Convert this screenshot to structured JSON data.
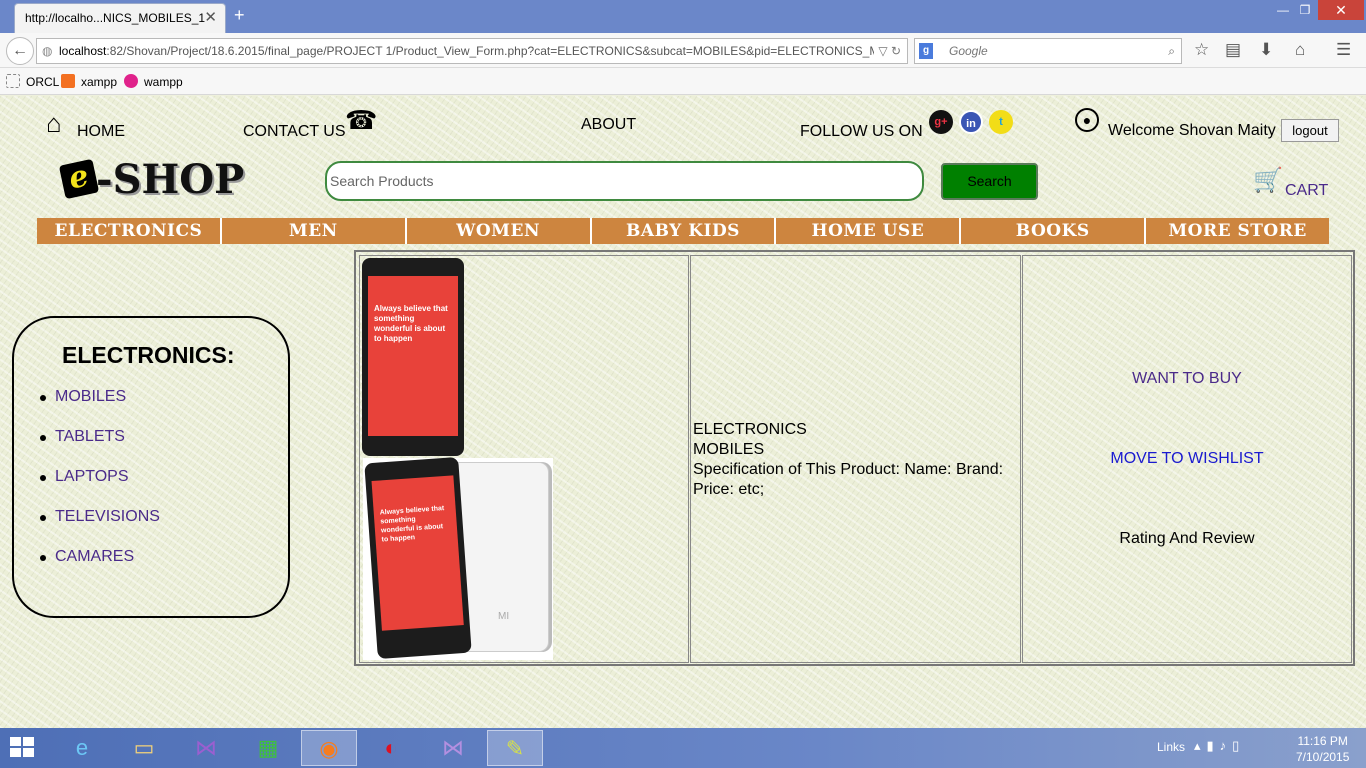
{
  "browser": {
    "tab_title": "http://localho...NICS_MOBILES_1",
    "tab_close": "✕",
    "new_tab": "+",
    "window_min": "—",
    "window_max": "❐",
    "window_close": "✕",
    "url_host": "localhost",
    "url_rest": ":82/Shovan/Project/18.6.2015/final_page/PROJECT 1/Product_View_Form.php?cat=ELECTRONICS&subcat=MOBILES&pid=ELECTRONICS_MOBI",
    "search_engine_badge": "g",
    "search_placeholder": "Google",
    "bookmarks": [
      {
        "label": "ORCL"
      },
      {
        "label": "xampp"
      },
      {
        "label": "wampp"
      }
    ]
  },
  "header": {
    "home": "HOME",
    "contact": "CONTACT US",
    "about": "ABOUT",
    "follow": "FOLLOW US ON",
    "social": [
      "g+",
      "in",
      "t"
    ],
    "welcome": "Welcome Shovan Maity",
    "logout": "logout"
  },
  "logo": {
    "mark": "e",
    "text": "-SHOP"
  },
  "search": {
    "placeholder": "Search Products",
    "button": "Search"
  },
  "cart": {
    "label": "CART"
  },
  "categories": [
    "ELECTRONICS",
    "MEN",
    "WOMEN",
    "BABY KIDS",
    "HOME USE",
    "BOOKS",
    "MORE STORE"
  ],
  "sidebar": {
    "title": "ELECTRONICS:",
    "items": [
      "MOBILES",
      "TABLETS",
      "LAPTOPS",
      "TELEVISIONS",
      "CAMARES"
    ]
  },
  "product": {
    "screen_text": "Always believe that something wonderful is about to happen",
    "brand_mark": "MI",
    "category": "ELECTRONICS",
    "subcategory": "MOBILES",
    "specification": "Specification of This Product: Name: Brand: Price: etc;",
    "want_to_buy": "WANT TO BUY",
    "wishlist": "MOVE TO WISHLIST",
    "rating": "Rating And Review"
  },
  "taskbar": {
    "links": "Links",
    "time": "11:16 PM",
    "date": "7/10/2015"
  },
  "colors": {
    "category_bar": "#cd853f",
    "search_button": "#008000",
    "link_purple": "#4a2a8a",
    "wishlist_blue": "#1a1ad0"
  }
}
